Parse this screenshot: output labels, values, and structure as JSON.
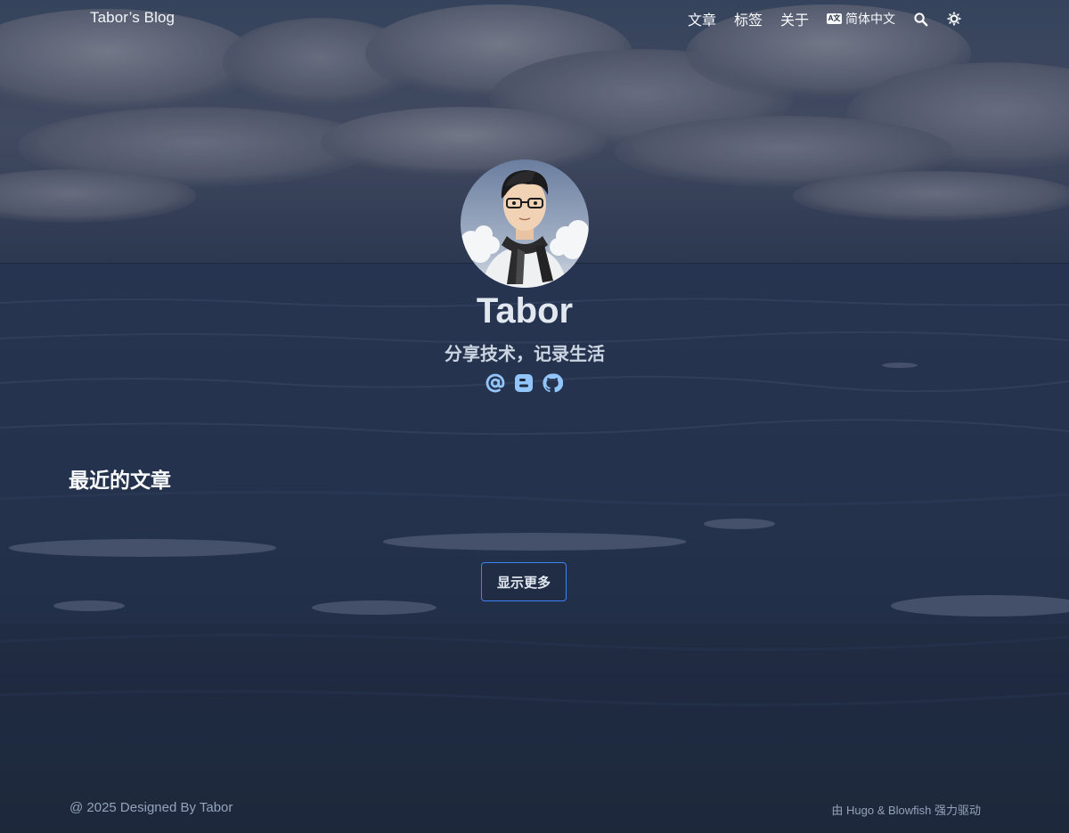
{
  "site": {
    "title": "Tabor’s Blog"
  },
  "nav": {
    "items": [
      {
        "label": "文章"
      },
      {
        "label": "标签"
      },
      {
        "label": "关于"
      }
    ],
    "language": {
      "icon": "translate-icon",
      "label": "简体中文"
    },
    "search": {
      "icon": "search-icon"
    },
    "appearance": {
      "icon": "sun-icon"
    }
  },
  "author": {
    "name": "Tabor",
    "headline": "分享技术，记录生活",
    "avatar_icon": "avatar-illustration",
    "links": [
      {
        "icon": "at-sign-icon"
      },
      {
        "icon": "blogger-icon"
      },
      {
        "icon": "github-icon"
      }
    ]
  },
  "recent": {
    "title": "最近的文章",
    "show_more": "显示更多"
  },
  "footer": {
    "copyright": "@ 2025 Designed By Tabor",
    "powered": "由 Hugo & Blowfish 强力驱动"
  },
  "colors": {
    "accent": "#3b82f6",
    "icon_accent": "#93c5fd",
    "bg_bottom": "#1e293b"
  }
}
